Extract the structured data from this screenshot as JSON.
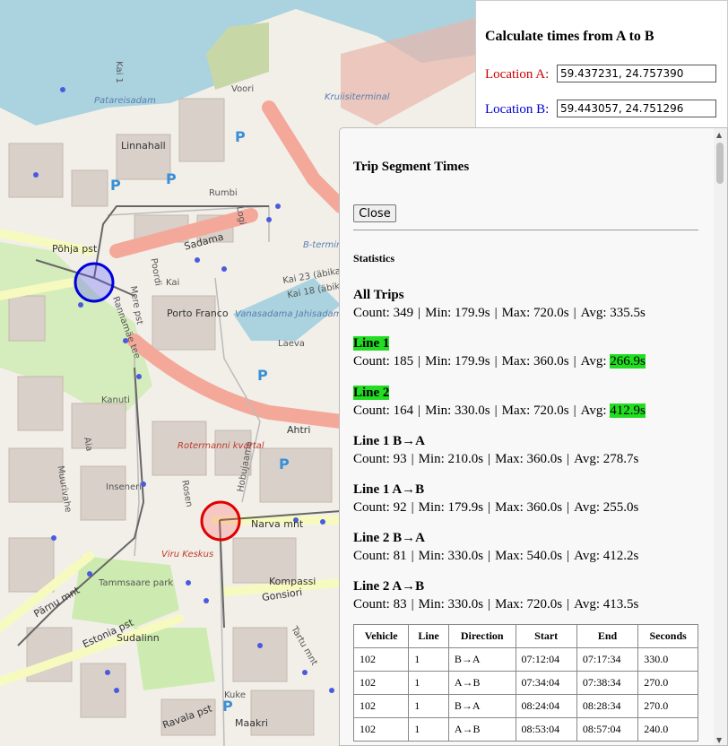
{
  "map": {
    "street_labels": [
      "Põhja pst",
      "Sadama",
      "Rumbi",
      "Poordi",
      "Kai",
      "Logi",
      "Ahtri",
      "Mere pst",
      "Rannamäe tee",
      "Narva mnt",
      "Estonia pst",
      "Gonsiori",
      "Pärnu mnt",
      "Kuke",
      "Ravala pst",
      "Tartu mnt",
      "Laeva",
      "Rosen",
      "Hobujaama",
      "Kanuti",
      "Inseneri",
      "Muurivahe",
      "Aia",
      "Vanasadama Jahisadam",
      "Porto Franco",
      "Linnahall",
      "Rotermanni kvartal",
      "Viru Keskus",
      "Tammsaare park",
      "Sudalinn",
      "Kompassi",
      "Maakri",
      "Patareisadam",
      "Kruiisiterminal",
      "B-terminal",
      "Kai 23 (äbikai)",
      "Kai 18 (äbikai)",
      "Voori",
      "Kai 1"
    ]
  },
  "calc": {
    "title": "Calculate times from A to B",
    "loc_a_label": "Location A:",
    "loc_a_value": "59.437231, 24.757390",
    "loc_b_label": "Location B:",
    "loc_b_value": "59.443057, 24.751296"
  },
  "segments": {
    "title": "Trip Segment Times",
    "close_label": "Close",
    "stats_title": "Statistics",
    "stats": [
      {
        "name": "All Trips",
        "count": "Count: 349",
        "min": "Min: 179.9s",
        "max": "Max: 720.0s",
        "avg_label": "Avg:",
        "avg": "335.5s",
        "highlight": false
      },
      {
        "name": "Line 1",
        "count": "Count: 185",
        "min": "Min: 179.9s",
        "max": "Max: 360.0s",
        "avg_label": "Avg:",
        "avg": "266.9s",
        "highlight": true
      },
      {
        "name": "Line 2",
        "count": "Count: 164",
        "min": "Min: 330.0s",
        "max": "Max: 720.0s",
        "avg_label": "Avg:",
        "avg": "412.9s",
        "highlight": true
      },
      {
        "name": "Line 1 B→A",
        "count": "Count: 93",
        "min": "Min: 210.0s",
        "max": "Max: 360.0s",
        "avg_label": "Avg:",
        "avg": "278.7s",
        "highlight": false
      },
      {
        "name": "Line 1 A→B",
        "count": "Count: 92",
        "min": "Min: 179.9s",
        "max": "Max: 360.0s",
        "avg_label": "Avg:",
        "avg": "255.0s",
        "highlight": false
      },
      {
        "name": "Line 2 B→A",
        "count": "Count: 81",
        "min": "Min: 330.0s",
        "max": "Max: 540.0s",
        "avg_label": "Avg:",
        "avg": "412.2s",
        "highlight": false
      },
      {
        "name": "Line 2 A→B",
        "count": "Count: 83",
        "min": "Min: 330.0s",
        "max": "Max: 720.0s",
        "avg_label": "Avg:",
        "avg": "413.5s",
        "highlight": false
      }
    ],
    "table": {
      "headers": [
        "Vehicle",
        "Line",
        "Direction",
        "Start",
        "End",
        "Seconds"
      ],
      "rows": [
        [
          "102",
          "1",
          "B→A",
          "07:12:04",
          "07:17:34",
          "330.0"
        ],
        [
          "102",
          "1",
          "A→B",
          "07:34:04",
          "07:38:34",
          "270.0"
        ],
        [
          "102",
          "1",
          "B→A",
          "08:24:04",
          "08:28:34",
          "270.0"
        ],
        [
          "102",
          "1",
          "A→B",
          "08:53:04",
          "08:57:04",
          "240.0"
        ]
      ]
    }
  },
  "colors": {
    "highlight": "#22dd22",
    "loc_a": "#cc0000",
    "loc_b": "#0000cc",
    "marker_a": "#e02020",
    "marker_b": "#2020e0"
  }
}
